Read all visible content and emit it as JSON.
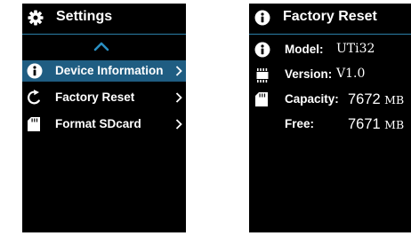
{
  "settings_screen": {
    "title": "Settings",
    "title_icon": "gear-icon",
    "scroll_up_icon": "chevron-up-icon",
    "menu": [
      {
        "label": "Device Information",
        "icon": "info-icon",
        "selected": true
      },
      {
        "label": "Factory Reset",
        "icon": "reset-icon",
        "selected": false
      },
      {
        "label": "Format SDcard",
        "icon": "sdcard-icon",
        "selected": false
      }
    ]
  },
  "info_screen": {
    "title": "Factory Reset",
    "title_icon": "info-icon",
    "rows": [
      {
        "label": "Model:",
        "value": "UTi32",
        "icon": "info-icon"
      },
      {
        "label": "Version:",
        "value": "V1.0",
        "icon": "chip-icon"
      },
      {
        "label": "Capacity:",
        "value_number": "7672",
        "value_unit": "MB",
        "icon": "sdcard-icon"
      },
      {
        "label": "Free:",
        "value_number": "7671",
        "value_unit": "MB"
      }
    ]
  },
  "colors": {
    "screen_bg": "#000000",
    "text": "#ffffff",
    "selection": "#1f5d82",
    "divider": "#2a7fa8"
  }
}
